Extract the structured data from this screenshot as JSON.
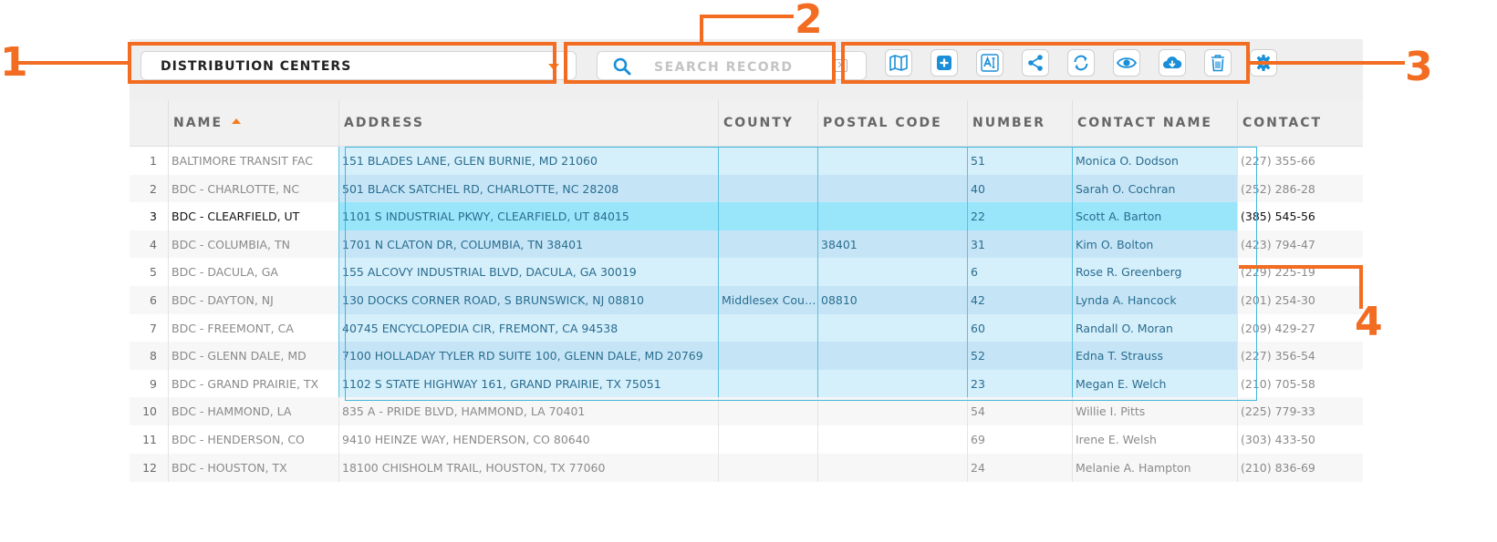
{
  "layer_select": {
    "value": "DISTRIBUTION CENTERS"
  },
  "search": {
    "placeholder": "SEARCH RECORD",
    "value": ""
  },
  "toolbar_icons": [
    "map-icon",
    "add-icon",
    "rename-text-icon",
    "share-icon",
    "refresh-icon",
    "view-icon",
    "download-cloud-icon",
    "delete-trash-icon",
    "settings-gear-icon"
  ],
  "table": {
    "columns": [
      "NAME",
      "ADDRESS",
      "COUNTY",
      "POSTAL CODE",
      "NUMBER",
      "CONTACT NAME",
      "CONTACT"
    ],
    "sort_column": "NAME",
    "rows": [
      [
        "1",
        "BALTIMORE TRANSIT FAC",
        "151 BLADES LANE, GLEN BURNIE, MD 21060",
        "",
        "",
        "51",
        "Monica O. Dodson",
        "(227) 355-66"
      ],
      [
        "2",
        "BDC - CHARLOTTE, NC",
        "501 BLACK SATCHEL RD, CHARLOTTE, NC 28208",
        "",
        "",
        "40",
        "Sarah O. Cochran",
        "(252) 286-28"
      ],
      [
        "3",
        "BDC - CLEARFIELD, UT",
        "1101 S INDUSTRIAL PKWY, CLEARFIELD, UT 84015",
        "",
        "",
        "22",
        "Scott A. Barton",
        "(385) 545-56"
      ],
      [
        "4",
        "BDC - COLUMBIA, TN",
        "1701 N CLATON DR, COLUMBIA, TN 38401",
        "",
        "38401",
        "31",
        "Kim O. Bolton",
        "(423) 794-47"
      ],
      [
        "5",
        "BDC - DACULA, GA",
        "155 ALCOVY INDUSTRIAL BLVD, DACULA, GA 30019",
        "",
        "",
        "6",
        "Rose R. Greenberg",
        "(229) 225-19"
      ],
      [
        "6",
        "BDC - DAYTON, NJ",
        "130 DOCKS CORNER ROAD, S BRUNSWICK, NJ 08810",
        "Middlesex Cou…",
        "08810",
        "42",
        "Lynda A. Hancock",
        "(201) 254-30"
      ],
      [
        "7",
        "BDC - FREEMONT, CA",
        "40745 ENCYCLOPEDIA CIR, FREMONT, CA 94538",
        "",
        "",
        "60",
        "Randall O. Moran",
        "(209) 429-27"
      ],
      [
        "8",
        "BDC - GLENN DALE, MD",
        "7100 HOLLADAY TYLER RD SUITE 100, GLENN DALE, MD 20769",
        "",
        "",
        "52",
        "Edna T. Strauss",
        "(227) 356-54"
      ],
      [
        "9",
        "BDC - GRAND PRAIRIE, TX",
        "1102 S STATE HIGHWAY 161, GRAND PRAIRIE, TX 75051",
        "",
        "",
        "23",
        "Megan E. Welch",
        "(210) 705-58"
      ],
      [
        "10",
        "BDC - HAMMOND, LA",
        "835 A - PRIDE BLVD, HAMMOND, LA 70401",
        "",
        "",
        "54",
        "Willie I. Pitts",
        "(225) 779-33"
      ],
      [
        "11",
        "BDC - HENDERSON, CO",
        "9410 HEINZE WAY, HENDERSON, CO 80640",
        "",
        "",
        "69",
        "Irene E. Welsh",
        "(303) 433-50"
      ],
      [
        "12",
        "BDC - HOUSTON, TX",
        "18100 CHISHOLM TRAIL, HOUSTON, TX 77060",
        "",
        "",
        "24",
        "Melanie A. Hampton",
        "(210) 836-69"
      ]
    ],
    "selected_rows": [
      1,
      2,
      3,
      4,
      5,
      6,
      7,
      8,
      9
    ],
    "active_row": 3
  },
  "callouts": [
    "1",
    "2",
    "3",
    "4"
  ],
  "colors": {
    "accent": "#f26c21",
    "icon_blue": "#1a8fd8",
    "selection": "#d5effb",
    "active_row": "#99e6fb"
  }
}
